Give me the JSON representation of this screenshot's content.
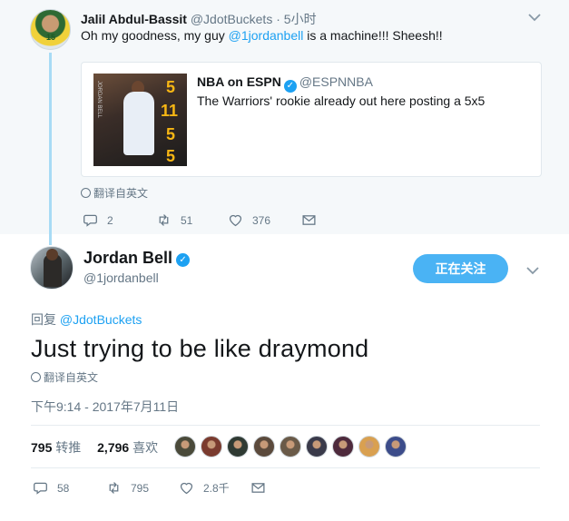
{
  "parent_tweet": {
    "author_name": "Jalil Abdul-Bassit",
    "author_handle": "@JdotBuckets",
    "time": "5小时",
    "avatar_number": "15",
    "text_before": "Oh my goodness, my guy ",
    "mention": "@1jordanbell",
    "text_after": " is a machine!!! Sheesh!!",
    "quoted": {
      "author_name": "NBA on ESPN",
      "author_handle": "@ESPNNBA",
      "text": "The Warriors' rookie already out here posting a 5x5",
      "media_stats": [
        "5",
        "11",
        "5",
        "5"
      ],
      "media_label": "JORDAN BELL"
    },
    "translate_label": "翻译自英文",
    "actions": {
      "reply_count": "2",
      "retweet_count": "51",
      "like_count": "376"
    }
  },
  "main_tweet": {
    "author_name": "Jordan Bell",
    "author_handle": "@1jordanbell",
    "follow_label": "正在关注",
    "reply_prefix": "回复 ",
    "reply_to": "@JdotBuckets",
    "text": "Just trying to be like draymond",
    "translate_label": "翻译自英文",
    "timestamp": "下午9:14 - 2017年7月11日",
    "stats": {
      "retweets_value": "795",
      "retweets_label": "转推",
      "likes_value": "2,796",
      "likes_label": "喜欢"
    },
    "liker_avatar_colors": [
      "#4a4a3a",
      "#7a3b2e",
      "#2f3a33",
      "#5b4a3c",
      "#6a5a48",
      "#3a3a4a",
      "#4e2a3c",
      "#d9a050",
      "#3c4c8a"
    ],
    "actions": {
      "reply_count": "58",
      "retweet_count": "795",
      "like_count": "2.8千"
    }
  },
  "colors": {
    "accent": "#1da1f2",
    "follow_button": "#4ab3f4",
    "thread_line": "#a8dbf5",
    "muted_text": "#657786",
    "stat_yellow": "#f7b614"
  }
}
